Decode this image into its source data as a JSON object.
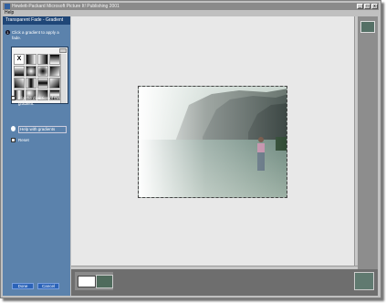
{
  "window": {
    "title": "Hewlett-Packard Microsoft Picture It! Publishing 2001",
    "minimize_glyph": "_",
    "maximize_glyph": "□",
    "close_glyph": "x"
  },
  "menu": {
    "help": "Help"
  },
  "task_pane": {
    "title": "Transparent Fade - Gradient",
    "step_number": "1",
    "step_text": "Click a gradient to apply a fade.",
    "flip_label": "Flip the direction of the gradient.",
    "help_label": "Help with gradients",
    "reset_label": "Reset",
    "done_label": "Done",
    "cancel_label": "Cancel",
    "swatches": [
      {
        "bg": "#ffffff",
        "mark": "X"
      },
      {
        "bg": "linear-gradient(90deg,#000,#fff)",
        "mark": ""
      },
      {
        "bg": "linear-gradient(90deg,#fff,#000)",
        "mark": ""
      },
      {
        "bg": "linear-gradient(180deg,#000,#fff)",
        "mark": ""
      },
      {
        "bg": "linear-gradient(180deg,#fff,#000)",
        "mark": ""
      },
      {
        "bg": "radial-gradient(#fff,#000)",
        "mark": ""
      },
      {
        "bg": "radial-gradient(#000,#fff)",
        "mark": ""
      },
      {
        "bg": "linear-gradient(135deg,#000,#fff)",
        "mark": ""
      },
      {
        "bg": "linear-gradient(45deg,#000,#fff)",
        "mark": ""
      },
      {
        "bg": "linear-gradient(90deg,#fff,#000,#fff)",
        "mark": ""
      },
      {
        "bg": "linear-gradient(180deg,#fff,#000,#fff)",
        "mark": ""
      },
      {
        "bg": "linear-gradient(135deg,#fff,#000)",
        "mark": ""
      },
      {
        "bg": "linear-gradient(90deg,#000,#fff,#000)",
        "mark": ""
      },
      {
        "bg": "radial-gradient(circle at 30% 30%,#fff,#000)",
        "mark": ""
      },
      {
        "bg": "linear-gradient(45deg,#fff,#000)",
        "mark": ""
      },
      {
        "bg": "linear-gradient(0deg,#000,#fff,#000)",
        "mark": ""
      }
    ]
  },
  "colors": {
    "pane": "#5b82ac",
    "pane_header": "#1f4677",
    "button": "#2b63b8",
    "workspace": "#e8e8e8"
  }
}
